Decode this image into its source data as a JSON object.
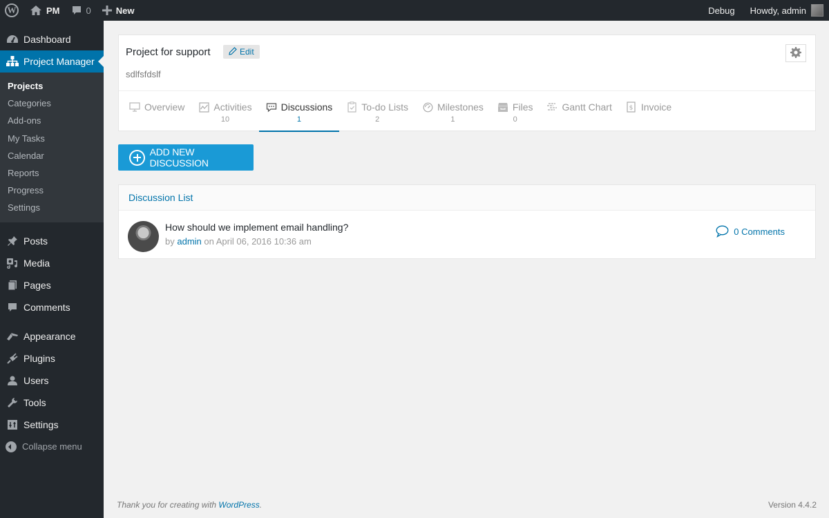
{
  "adminbar": {
    "site_name": "PM",
    "comments_count": "0",
    "new_label": "New",
    "debug_label": "Debug",
    "greeting": "Howdy, admin"
  },
  "sidebar": {
    "dashboard": "Dashboard",
    "project_manager": "Project Manager",
    "submenu": [
      {
        "label": "Projects",
        "current": true
      },
      {
        "label": "Categories"
      },
      {
        "label": "Add-ons"
      },
      {
        "label": "My Tasks"
      },
      {
        "label": "Calendar"
      },
      {
        "label": "Reports"
      },
      {
        "label": "Progress"
      },
      {
        "label": "Settings"
      }
    ],
    "items": [
      {
        "label": "Posts",
        "icon": "pin-icon"
      },
      {
        "label": "Media",
        "icon": "media-icon"
      },
      {
        "label": "Pages",
        "icon": "pages-icon"
      },
      {
        "label": "Comments",
        "icon": "comment-icon"
      },
      {
        "label": "Appearance",
        "icon": "brush-icon"
      },
      {
        "label": "Plugins",
        "icon": "plugin-icon"
      },
      {
        "label": "Users",
        "icon": "user-icon"
      },
      {
        "label": "Tools",
        "icon": "wrench-icon"
      },
      {
        "label": "Settings",
        "icon": "settings-icon"
      }
    ],
    "collapse": "Collapse menu"
  },
  "project": {
    "title": "Project for support",
    "edit_label": "Edit",
    "description": "sdlfsfdslf"
  },
  "tabs": [
    {
      "label": "Overview",
      "count": ""
    },
    {
      "label": "Activities",
      "count": "10"
    },
    {
      "label": "Discussions",
      "count": "1",
      "active": true
    },
    {
      "label": "To-do Lists",
      "count": "2"
    },
    {
      "label": "Milestones",
      "count": "1"
    },
    {
      "label": "Files",
      "count": "0"
    },
    {
      "label": "Gantt Chart",
      "count": ""
    },
    {
      "label": "Invoice",
      "count": ""
    }
  ],
  "add_button": "ADD NEW DISCUSSION",
  "discussion_list": {
    "header": "Discussion List",
    "items": [
      {
        "title": "How should we implement email handling?",
        "by": "by",
        "author": "admin",
        "on": "on April 06, 2016 10:36 am",
        "comments": "0 Comments"
      }
    ]
  },
  "footer": {
    "thanks_prefix": "Thank you for creating with ",
    "wordpress_link": "WordPress",
    "thanks_suffix": ".",
    "version": "Version 4.4.2"
  },
  "colors": {
    "accent": "#0073aa",
    "button": "#1a9ad6",
    "adminbar_bg": "#23282d"
  }
}
